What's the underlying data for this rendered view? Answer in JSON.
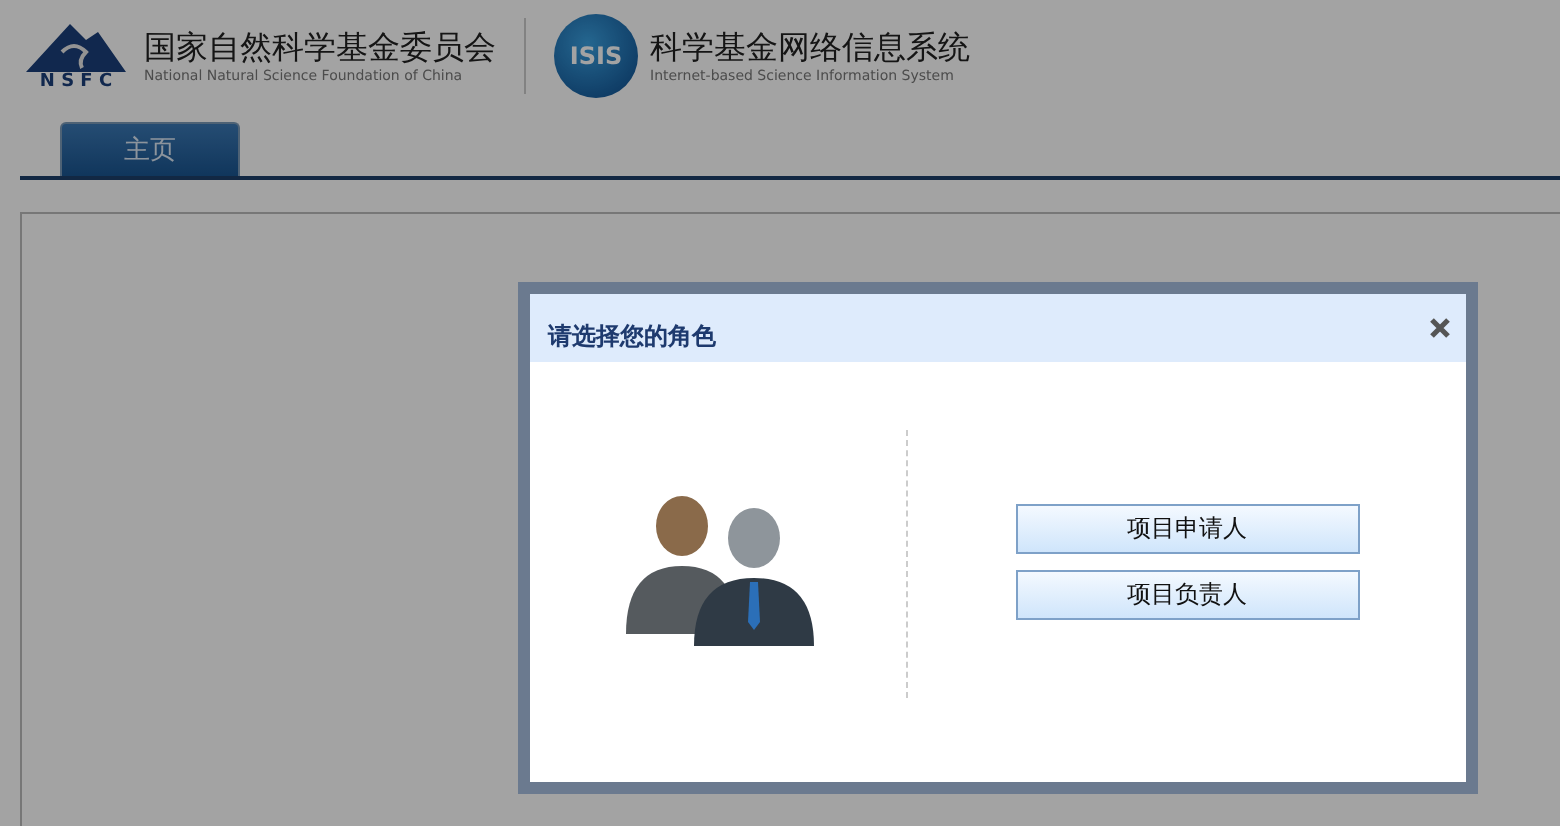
{
  "header": {
    "org_name": "国家自然科学基金委员会",
    "org_subtitle": "National Natural Science Foundation of China",
    "org_logo_text": "N S F C",
    "system_name": "科学基金网络信息系统",
    "system_subtitle": "Internet-based Science Information System",
    "system_logo_text": "ISIS"
  },
  "tabs": [
    {
      "label": "主页",
      "selected": true
    }
  ],
  "dialog": {
    "title": "请选择您的角色",
    "roles": [
      {
        "label": "项目申请人"
      },
      {
        "label": "项目负责人"
      }
    ]
  }
}
